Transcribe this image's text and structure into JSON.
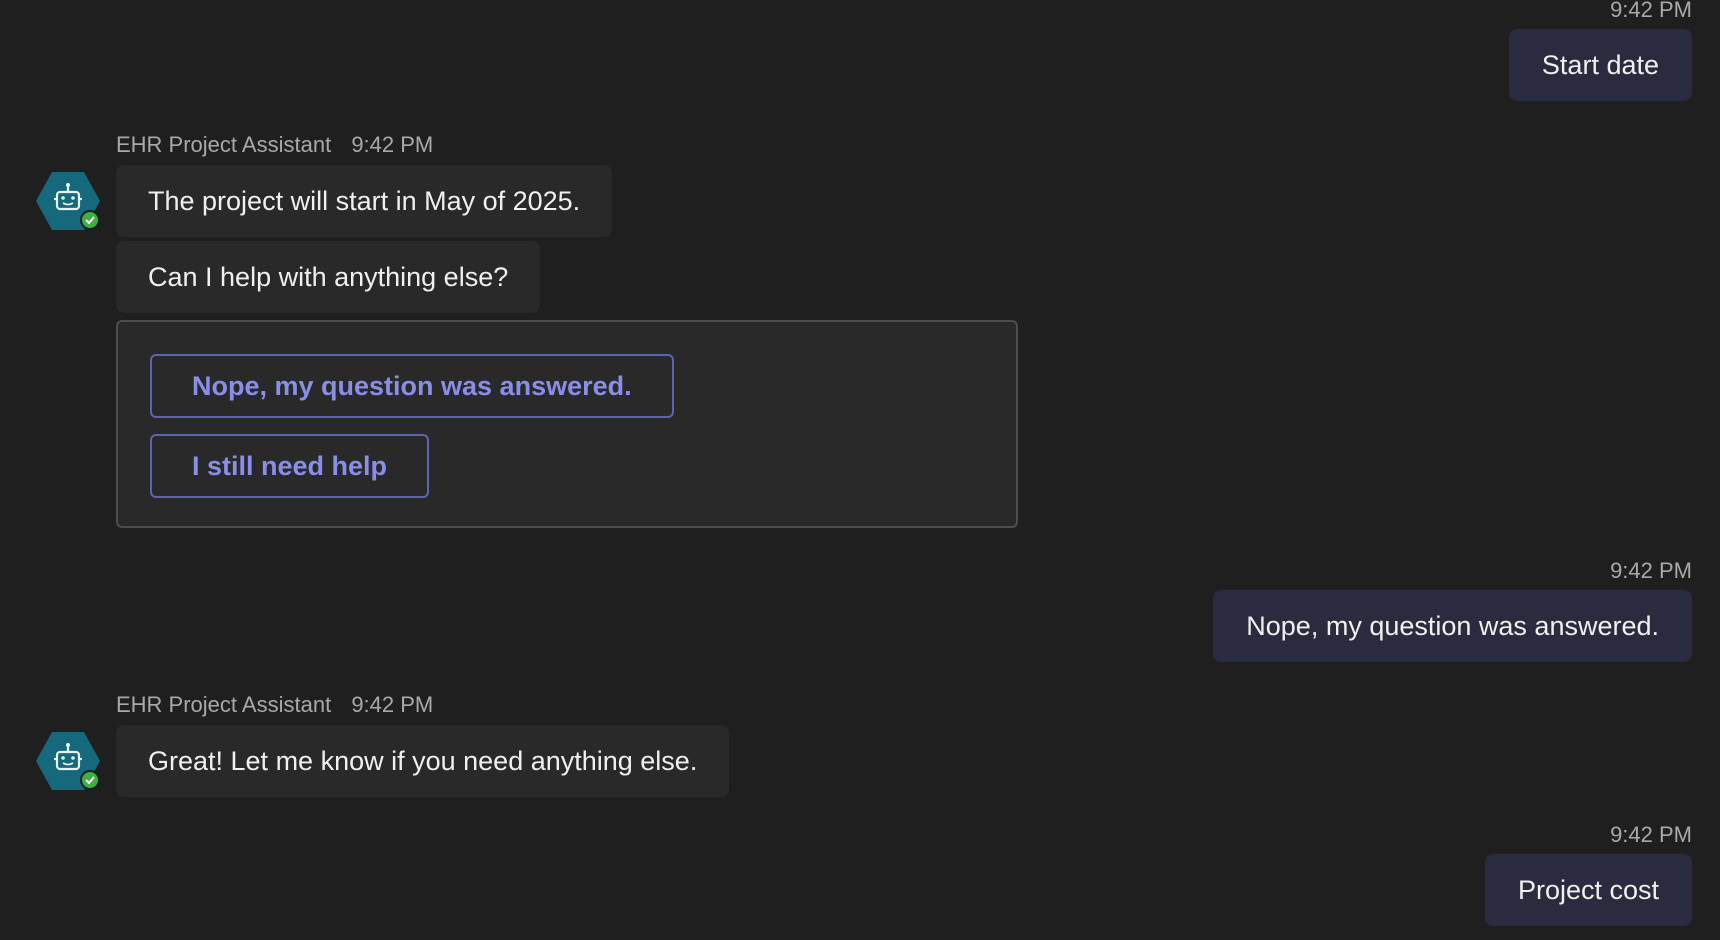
{
  "messages": [
    {
      "type": "outgoing",
      "time": "9:42 PM",
      "text": "Start date"
    },
    {
      "type": "incoming",
      "sender": "EHR Project Assistant",
      "time": "9:42 PM",
      "texts": [
        "The project will start in May of 2025.",
        "Can I help with anything else?"
      ],
      "card": {
        "buttons": [
          "Nope, my question was answered.",
          "I still need help"
        ]
      }
    },
    {
      "type": "outgoing",
      "time": "9:42 PM",
      "text": "Nope, my question was answered."
    },
    {
      "type": "incoming",
      "sender": "EHR Project Assistant",
      "time": "9:42 PM",
      "texts": [
        "Great! Let me know if you need anything else."
      ]
    },
    {
      "type": "outgoing",
      "time": "9:42 PM",
      "text": "Project cost"
    }
  ],
  "colors": {
    "background": "#1f1f1f",
    "outgoing_bubble": "#2b2b40",
    "incoming_bubble": "#292929",
    "accent": "#8b8ee8",
    "avatar": "#16687c",
    "status_ok": "#3cb043"
  },
  "icons": {
    "avatar": "bot-icon",
    "status": "check-circle-icon"
  }
}
